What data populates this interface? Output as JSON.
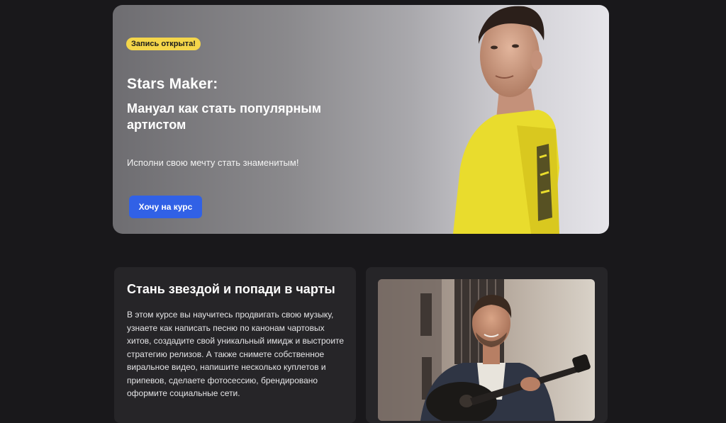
{
  "hero": {
    "badge": "Запись открыта!",
    "title": "Stars Maker:",
    "subtitle": "Мануал как стать популярным артистом",
    "description": "Исполни свою мечту стать знаменитым!",
    "cta_label": "Хочу на курс",
    "colors": {
      "badge": "#f4d64a",
      "cta": "#3161e6",
      "shirt": "#e9dc2d"
    }
  },
  "about": {
    "title": "Стань звездой и попади в чарты",
    "body": "В этом курсе вы научитесь продвигать свою музыку, узнаете как написать песню по канонам чартовых хитов, создадите свой уникальный имидж и выстроите стратегию релизов. А также снимете собственное виральное видео, напишите несколько куплетов и припевов, сделаете фотосессию, брендировано оформите социальные сети."
  },
  "colors": {
    "page_bg": "#19181b",
    "card_bg": "#262528"
  }
}
